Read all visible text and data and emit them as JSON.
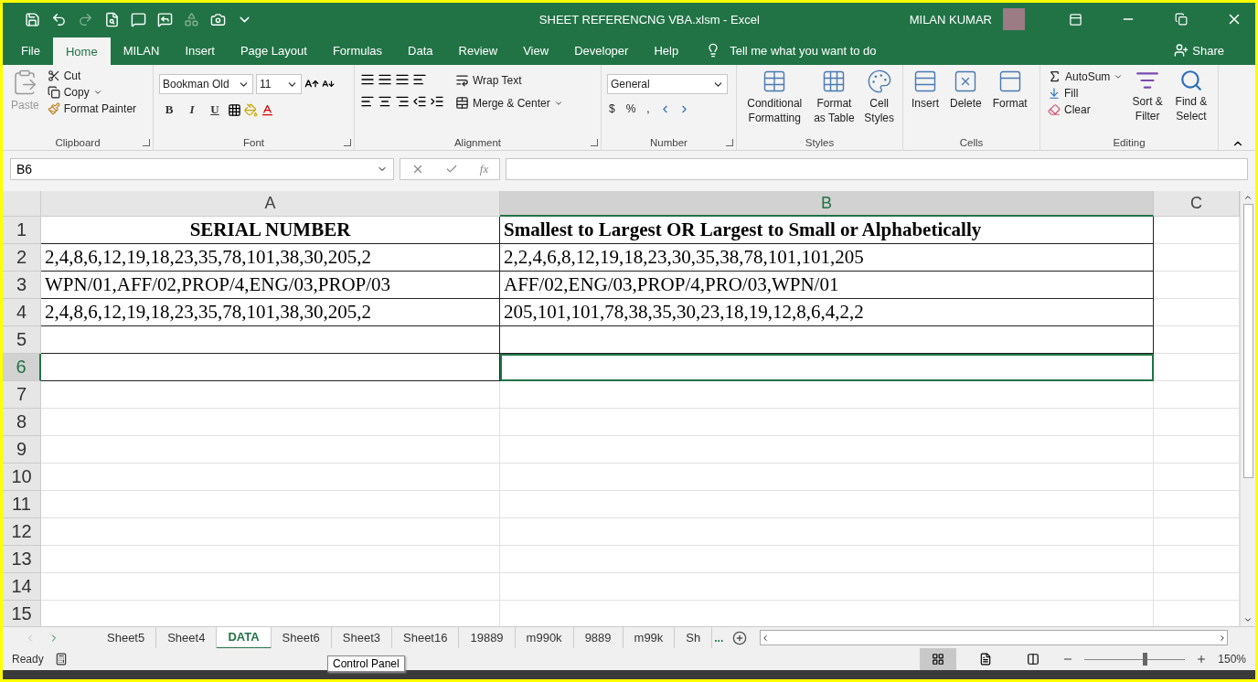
{
  "title_bar": {
    "quick_access": [
      {
        "kind": "save",
        "disabled": false
      },
      {
        "kind": "undo",
        "disabled": false
      },
      {
        "kind": "redo",
        "disabled": true
      },
      {
        "kind": "preview",
        "disabled": false
      },
      {
        "kind": "comment",
        "disabled": false
      },
      {
        "kind": "reply",
        "disabled": false
      },
      {
        "kind": "shape",
        "disabled": true
      },
      {
        "kind": "camera",
        "disabled": false
      },
      {
        "kind": "customize",
        "disabled": false
      }
    ],
    "title": "SHEET REFERENCNG VBA.xlsm  -  Excel",
    "user": "MILAN KUMAR"
  },
  "ribbon_tabs": [
    {
      "label": "File",
      "selected": false
    },
    {
      "label": "Home",
      "selected": true
    },
    {
      "label": "MILAN",
      "selected": false
    },
    {
      "label": "Insert",
      "selected": false
    },
    {
      "label": "Page Layout",
      "selected": false
    },
    {
      "label": "Formulas",
      "selected": false
    },
    {
      "label": "Data",
      "selected": false
    },
    {
      "label": "Review",
      "selected": false
    },
    {
      "label": "View",
      "selected": false
    },
    {
      "label": "Developer",
      "selected": false
    },
    {
      "label": "Help",
      "selected": false
    }
  ],
  "tell_me": "Tell me what you want to do",
  "share": "Share",
  "clipboard": {
    "paste": "Paste",
    "paste_disabled": true,
    "cut": "Cut",
    "copy": "Copy",
    "format_painter": "Format Painter",
    "label": "Clipboard"
  },
  "font": {
    "name": "Bookman Old",
    "size": "11",
    "bold": "B",
    "italic": "I",
    "underline": "U",
    "label": "Font"
  },
  "alignment": {
    "wrap_text": "Wrap Text",
    "merge": "Merge & Center",
    "label": "Alignment"
  },
  "number": {
    "format": "General",
    "currency": "$",
    "percent": "%",
    "comma": ",",
    "label": "Number"
  },
  "styles": {
    "items": [
      "Conditional Formatting",
      "Format as Table",
      "Cell Styles"
    ],
    "label": "Styles"
  },
  "cells": {
    "items": [
      "Insert",
      "Delete",
      "Format"
    ],
    "label": "Cells"
  },
  "editing": {
    "autosum": "AutoSum",
    "fill": "Fill",
    "clear": "Clear",
    "sort": "Sort & Filter",
    "find": "Find & Select",
    "label": "Editing"
  },
  "formula_bar": {
    "name_box": "B6",
    "fx": "fx"
  },
  "columns": [
    {
      "label": "A",
      "selected": false
    },
    {
      "label": "B",
      "selected": true
    },
    {
      "label": "C",
      "selected": false
    }
  ],
  "rows": [
    {
      "number": "1",
      "kind": "heading",
      "selected": false,
      "cells": [
        {
          "text": "SERIAL NUMBER",
          "active": false
        },
        {
          "text": "Smallest to Largest OR Largest to Small or Alphabetically",
          "active": false
        }
      ]
    },
    {
      "number": "2",
      "kind": "data",
      "selected": false,
      "cells": [
        {
          "text": "2,4,8,6,12,19,18,23,35,78,101,38,30,205,2",
          "active": false
        },
        {
          "text": "2,2,4,6,8,12,19,18,23,30,35,38,78,101,101,205",
          "active": false
        }
      ]
    },
    {
      "number": "3",
      "kind": "data",
      "selected": false,
      "cells": [
        {
          "text": "WPN/01,AFF/02,PROP/4,ENG/03,PROP/03",
          "active": false
        },
        {
          "text": "AFF/02,ENG/03,PROP/4,PRO/03,WPN/01",
          "active": false
        }
      ]
    },
    {
      "number": "4",
      "kind": "data",
      "selected": false,
      "cells": [
        {
          "text": "2,4,8,6,12,19,18,23,35,78,101,38,30,205,2",
          "active": false
        },
        {
          "text": "205,101,101,78,38,35,30,23,18,19,12,8,6,4,2,2",
          "active": false
        }
      ]
    },
    {
      "number": "5",
      "kind": "data",
      "selected": false,
      "cells": []
    },
    {
      "number": "6",
      "kind": "data",
      "selected": true,
      "cells": [
        {
          "active": false
        },
        {
          "active": true
        }
      ]
    },
    {
      "number": "7",
      "kind": "data",
      "selected": false,
      "cells": []
    },
    {
      "number": "8",
      "kind": "data",
      "selected": false,
      "cells": []
    },
    {
      "number": "9",
      "kind": "data",
      "selected": false,
      "cells": []
    },
    {
      "number": "10",
      "kind": "data",
      "selected": false,
      "cells": []
    },
    {
      "number": "11",
      "kind": "data",
      "selected": false,
      "cells": []
    },
    {
      "number": "12",
      "kind": "data",
      "selected": false,
      "cells": []
    },
    {
      "number": "13",
      "kind": "data",
      "selected": false,
      "cells": []
    },
    {
      "number": "14",
      "kind": "data",
      "selected": false,
      "cells": []
    },
    {
      "number": "15",
      "kind": "data",
      "selected": false,
      "cells": []
    }
  ],
  "sheet_tabs": [
    {
      "label": "Sheet5",
      "selected": false
    },
    {
      "label": "Sheet4",
      "selected": false
    },
    {
      "label": "DATA",
      "selected": true
    },
    {
      "label": "Sheet6",
      "selected": false
    },
    {
      "label": "Sheet3",
      "selected": false
    },
    {
      "label": "Sheet16",
      "selected": false
    },
    {
      "label": "19889",
      "selected": false
    },
    {
      "label": "m990k",
      "selected": false
    },
    {
      "label": "9889",
      "selected": false
    },
    {
      "label": "m99k",
      "selected": false
    },
    {
      "label": "Sh",
      "selected": false
    }
  ],
  "more_tabs": "...",
  "tooltip": "Control Panel",
  "status": {
    "text": "Ready",
    "views": [
      {
        "kind": "normal",
        "selected": true
      },
      {
        "kind": "page",
        "selected": false
      },
      {
        "kind": "break",
        "selected": false
      }
    ],
    "zoom": {
      "level": 0.6,
      "text": "150%"
    }
  }
}
